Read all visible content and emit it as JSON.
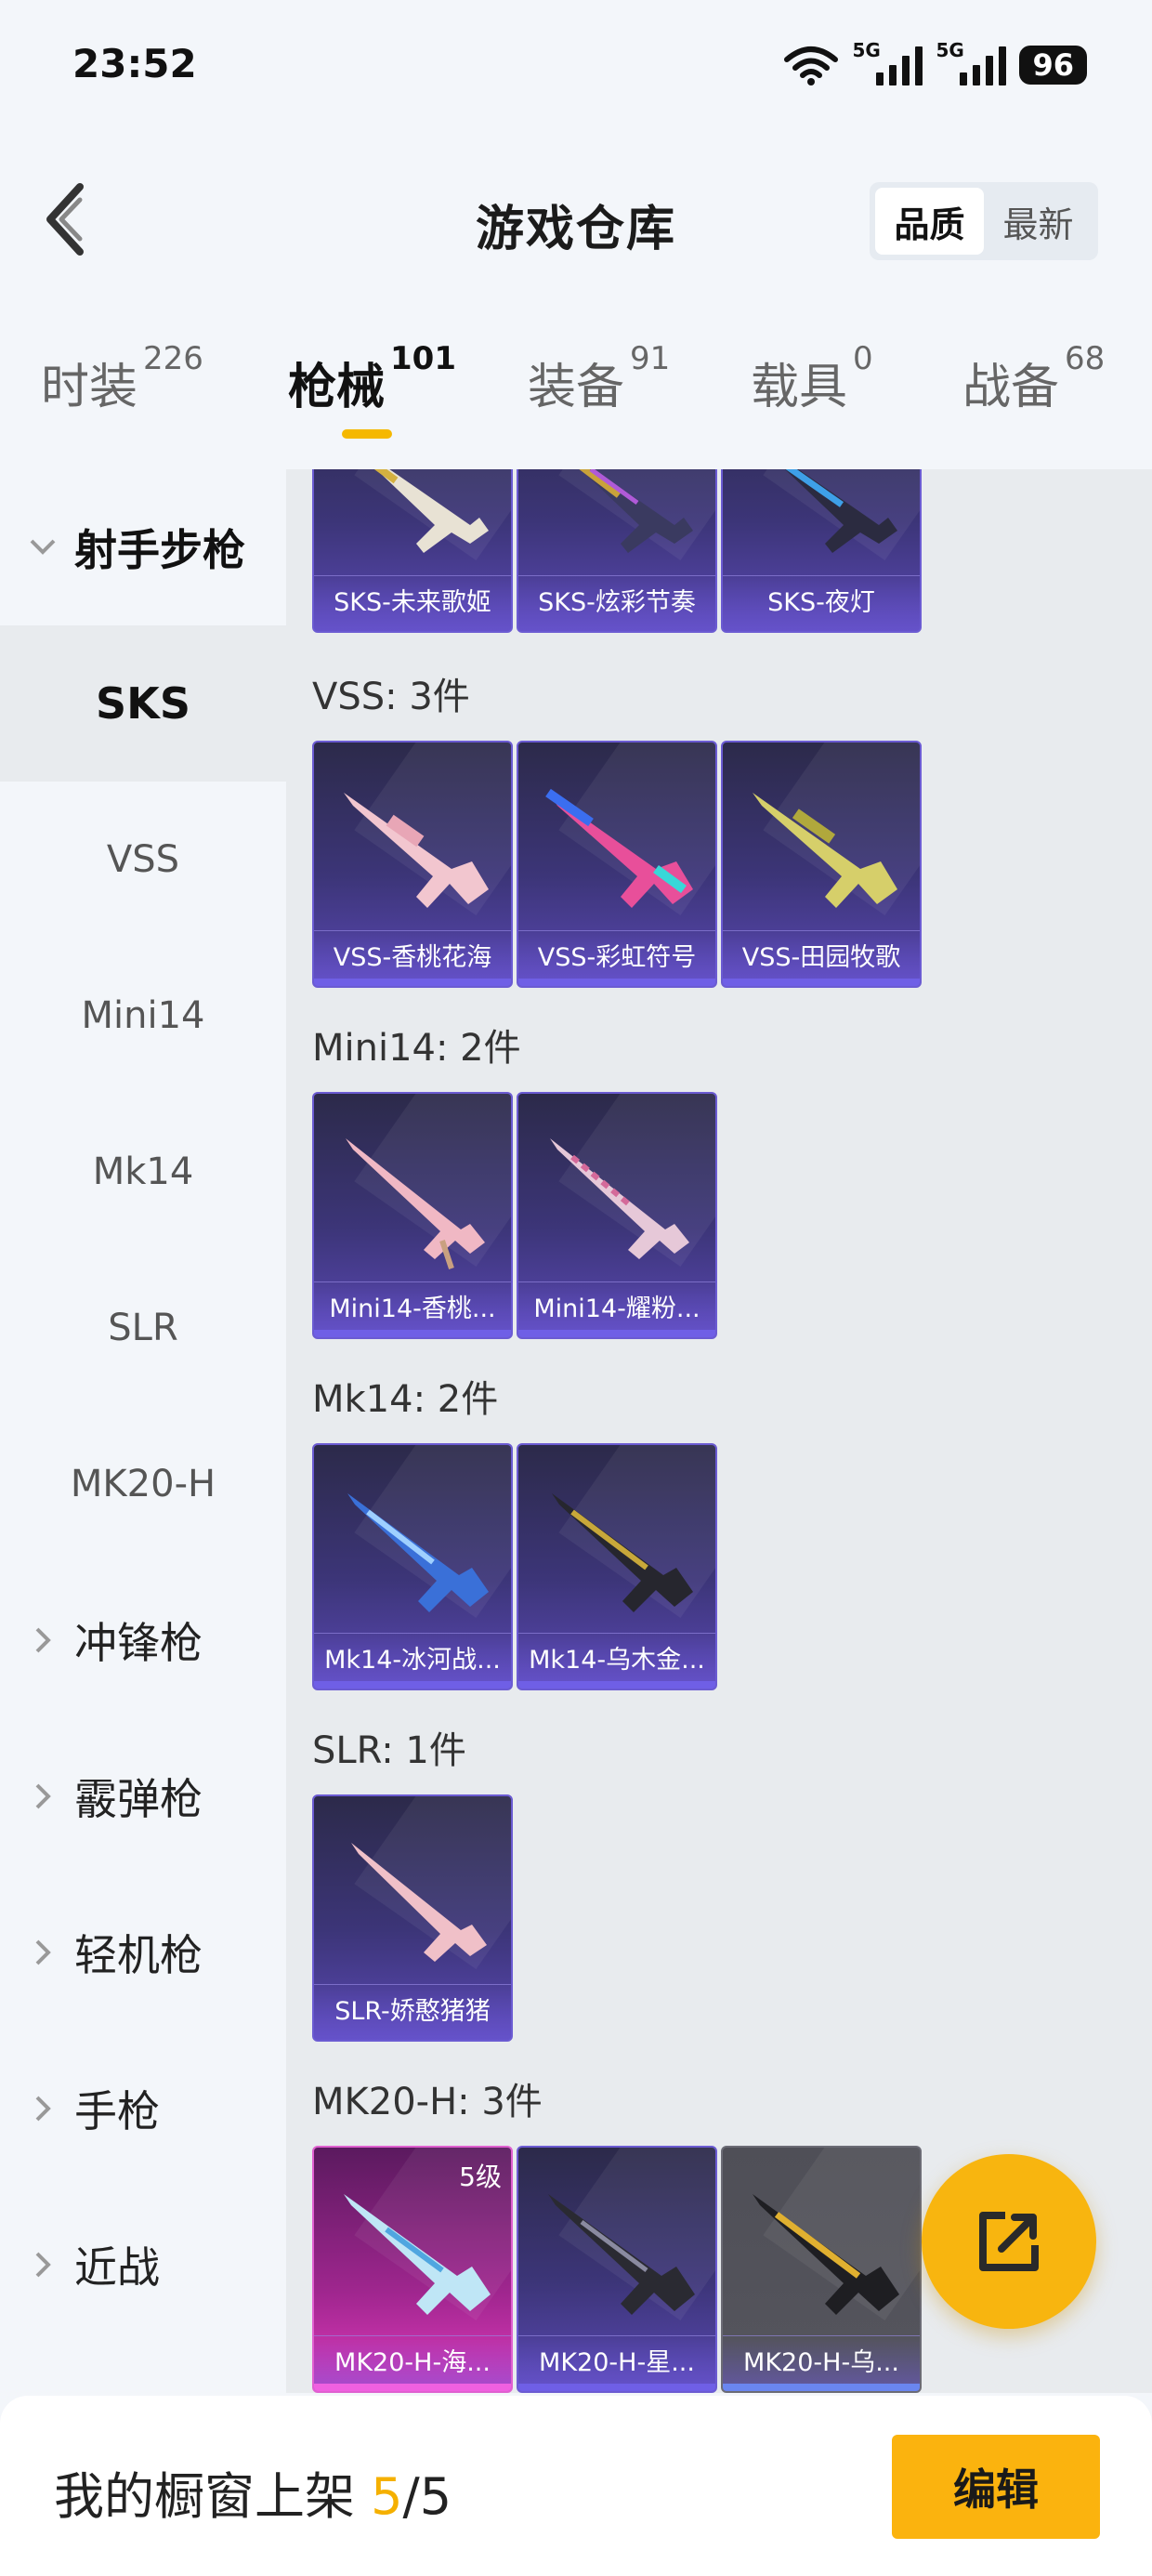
{
  "status_bar": {
    "time": "23:52",
    "net1": "5G",
    "net2": "5G",
    "battery": "96"
  },
  "header": {
    "title": "游戏仓库",
    "sort_options": [
      "品质",
      "最新"
    ]
  },
  "tabs": [
    {
      "label": "时装",
      "count": "226"
    },
    {
      "label": "枪械",
      "count": "101"
    },
    {
      "label": "装备",
      "count": "91"
    },
    {
      "label": "载具",
      "count": "0"
    },
    {
      "label": "战备",
      "count": "68"
    }
  ],
  "sidebar": {
    "groups": [
      {
        "label": "射手步枪",
        "subs": [
          "SKS",
          "VSS",
          "Mini14",
          "Mk14",
          "SLR",
          "MK20-H"
        ]
      },
      {
        "label": "冲锋枪"
      },
      {
        "label": "霰弹枪"
      },
      {
        "label": "轻机枪"
      },
      {
        "label": "手枪"
      },
      {
        "label": "近战"
      }
    ]
  },
  "sections": [
    {
      "title": "",
      "items": [
        "SKS-未来歌姬",
        "SKS-炫彩节奏",
        "SKS-夜灯"
      ]
    },
    {
      "title": "VSS: 3件",
      "items": [
        "VSS-香桃花海",
        "VSS-彩虹符号",
        "VSS-田园牧歌"
      ]
    },
    {
      "title": "Mini14: 2件",
      "items": [
        "Mini14-香桃...",
        "Mini14-耀粉..."
      ]
    },
    {
      "title": "Mk14: 2件",
      "items": [
        "Mk14-冰河战...",
        "Mk14-乌木金..."
      ]
    },
    {
      "title": "SLR: 1件",
      "items": [
        "SLR-娇憨猪猪"
      ]
    },
    {
      "title": "MK20-H: 3件",
      "items": [
        "MK20-H-海...",
        "MK20-H-星...",
        "MK20-H-乌..."
      ],
      "first_level": "5级"
    }
  ],
  "bottom": {
    "label": "我的橱窗上架",
    "current": "5",
    "total": "/5",
    "edit_label": "编辑"
  },
  "colors": {
    "accent": "#f5b800",
    "card_purple": "#3c3578",
    "card_pink": "#a0268f"
  }
}
